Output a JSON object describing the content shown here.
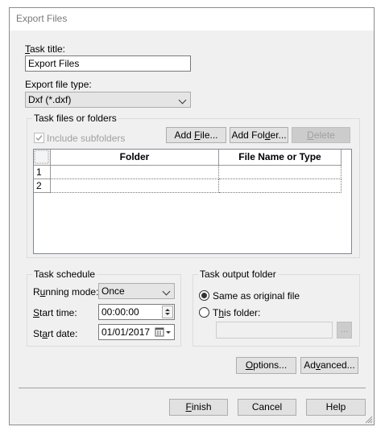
{
  "window": {
    "title": "Export Files"
  },
  "task_title": {
    "label_prefix": "",
    "label_u": "T",
    "label_rest": "ask title:",
    "value": "Export Files"
  },
  "export_type": {
    "label": "Export file type:",
    "value": "Dxf (*.dxf)"
  },
  "task_files": {
    "group_title": "Task files or folders",
    "include_subfolders": "Include subfolders",
    "add_file": {
      "pre": "Add ",
      "u": "F",
      "post": "ile..."
    },
    "add_folder": {
      "pre": "Add Fol",
      "u": "d",
      "post": "er..."
    },
    "delete": {
      "pre": "",
      "u": "D",
      "post": "elete"
    },
    "columns": [
      "Folder",
      "File Name or Type"
    ],
    "rows": [
      {
        "num": "1",
        "folder": "",
        "file": ""
      },
      {
        "num": "2",
        "folder": "",
        "file": ""
      }
    ]
  },
  "schedule": {
    "group_title": "Task schedule",
    "running_mode_label": {
      "pre": "R",
      "u": "u",
      "post": "nning mode:"
    },
    "running_mode_value": "Once",
    "start_time_label": {
      "pre": "",
      "u": "S",
      "post": "tart time:"
    },
    "start_time_value": "00:00:00",
    "start_date_label": {
      "pre": "St",
      "u": "a",
      "post": "rt date:"
    },
    "start_date_value": "01/01/2017"
  },
  "output": {
    "group_title": "Task output folder",
    "same_as_original": "Same as original file",
    "this_folder": {
      "pre": "T",
      "u": "h",
      "post": "is folder:"
    },
    "folder_value": "",
    "browse": "..."
  },
  "buttons": {
    "options": {
      "pre": "",
      "u": "O",
      "post": "ptions..."
    },
    "advanced": {
      "pre": "Ad",
      "u": "v",
      "post": "anced..."
    },
    "finish": {
      "pre": "",
      "u": "F",
      "post": "inish"
    },
    "cancel": "Cancel",
    "help": "Help"
  },
  "colors": {
    "dialog_bg": "#f0f0f0",
    "button_bg": "#e1e1e1",
    "border": "#adadad",
    "disabled_text": "#a0a0a0"
  }
}
